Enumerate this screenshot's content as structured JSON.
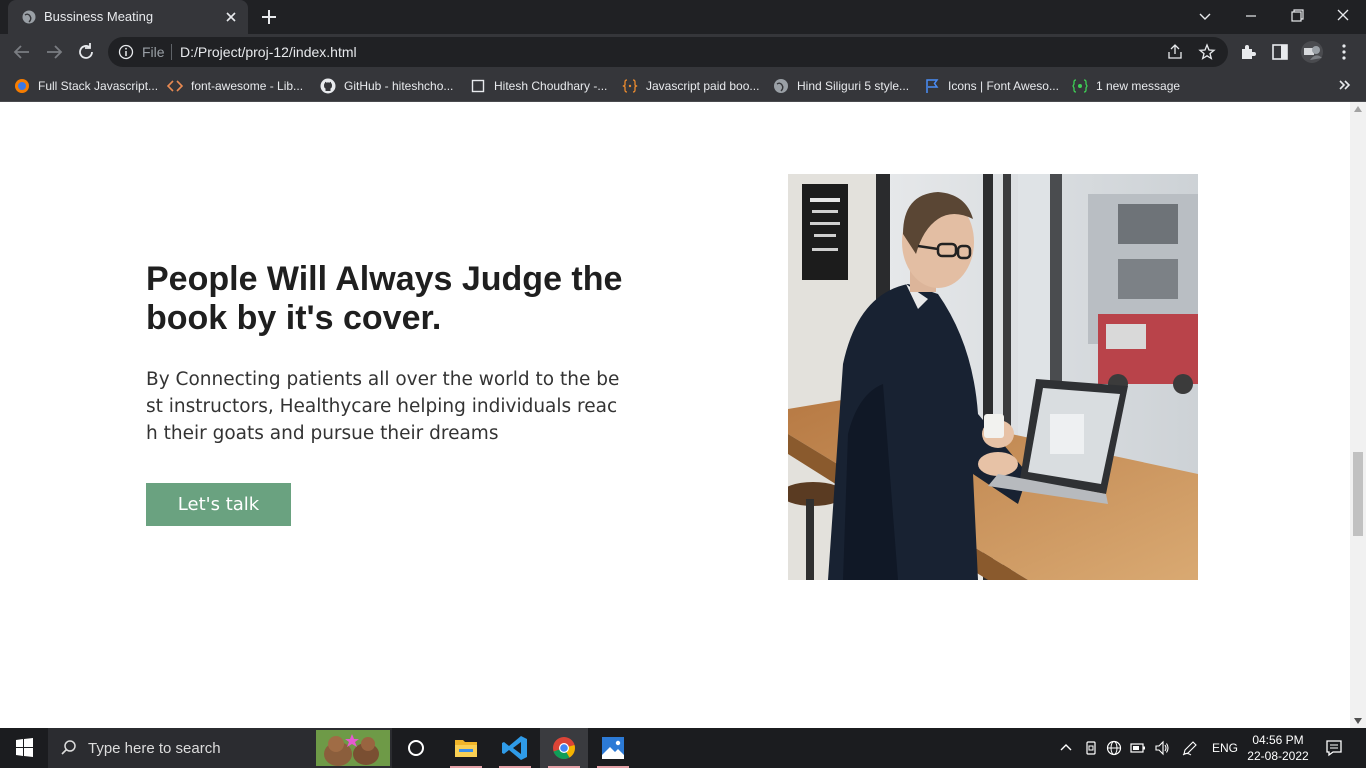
{
  "browser": {
    "tab_title": "Bussiness Meating",
    "scheme_label": "File",
    "url": "D:/Project/proj-12/index.html",
    "bookmarks": [
      {
        "label": "Full Stack Javascript...",
        "icon": "orange-circle-icon"
      },
      {
        "label": "font-awesome - Lib...",
        "icon": "code-brackets-icon"
      },
      {
        "label": "GitHub - hiteshcho...",
        "icon": "github-icon"
      },
      {
        "label": "Hitesh Choudhary -...",
        "icon": "page-icon"
      },
      {
        "label": "Javascript paid boo...",
        "icon": "braces-icon"
      },
      {
        "label": "Hind Siliguri 5 style...",
        "icon": "globe-icon"
      },
      {
        "label": "Icons | Font Aweso...",
        "icon": "flag-icon"
      },
      {
        "label": "1 new message",
        "icon": "chat-icon"
      }
    ]
  },
  "page": {
    "heading": "People Will Always Judge the book by it's cover.",
    "description": "By Connecting patients all over the world to the best instructors, Healthycare helping individuals reach their goats and pursue their dreams",
    "cta_label": "Let's talk",
    "accent_color": "#6aa280"
  },
  "taskbar": {
    "search_placeholder": "Type here to search",
    "language": "ENG",
    "time": "04:56 PM",
    "date": "22-08-2022"
  }
}
